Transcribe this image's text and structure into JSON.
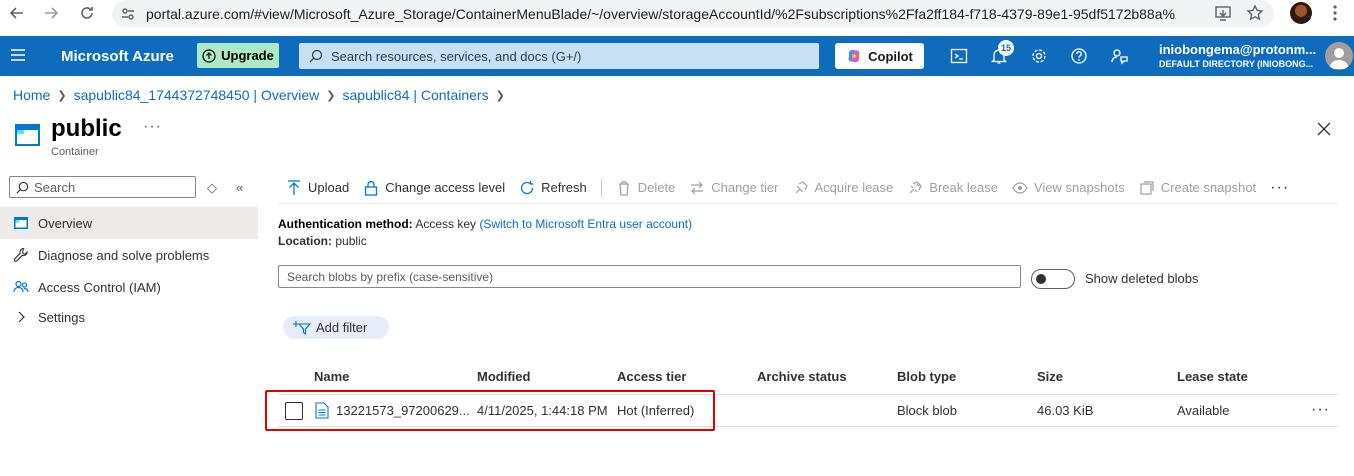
{
  "browser": {
    "url": "portal.azure.com/#view/Microsoft_Azure_Storage/ContainerMenuBlade/~/overview/storageAccountId/%2Fsubscriptions%2Ffa2ff184-f718-4379-89e1-95df5172b88a%2..."
  },
  "header": {
    "brand": "Microsoft Azure",
    "upgrade_label": "Upgrade",
    "search_placeholder": "Search resources, services, and docs (G+/)",
    "copilot_label": "Copilot",
    "notification_count": "15",
    "user_name": "iniobongema@protonm...",
    "user_directory": "DEFAULT DIRECTORY (INIOBONG..."
  },
  "breadcrumb": [
    "Home",
    "sapublic84_1744372748450 | Overview",
    "sapublic84 | Containers"
  ],
  "page": {
    "title": "public",
    "subtitle": "Container",
    "more": "···"
  },
  "sidebar": {
    "search_placeholder": "Search",
    "items": [
      {
        "label": "Overview"
      },
      {
        "label": "Diagnose and solve problems"
      },
      {
        "label": "Access Control (IAM)"
      },
      {
        "label": "Settings"
      }
    ]
  },
  "toolbar": {
    "upload": "Upload",
    "change_access": "Change access level",
    "refresh": "Refresh",
    "delete": "Delete",
    "change_tier": "Change tier",
    "acquire_lease": "Acquire lease",
    "break_lease": "Break lease",
    "view_snapshots": "View snapshots",
    "create_snapshot": "Create snapshot",
    "more": "···"
  },
  "info": {
    "auth_label": "Authentication method:",
    "auth_value": "Access key",
    "auth_link": "(Switch to Microsoft Entra user account)",
    "location_label": "Location:",
    "location_value": "public"
  },
  "blob_search_placeholder": "Search blobs by prefix (case-sensitive)",
  "show_deleted_label": "Show deleted blobs",
  "add_filter_label": "Add filter",
  "table": {
    "headers": [
      "Name",
      "Modified",
      "Access tier",
      "Archive status",
      "Blob type",
      "Size",
      "Lease state"
    ],
    "rows": [
      {
        "name": "13221573_97200629...",
        "modified": "4/11/2025, 1:44:18 PM",
        "access_tier": "Hot (Inferred)",
        "archive_status": "",
        "blob_type": "Block blob",
        "size": "46.03 KiB",
        "lease_state": "Available",
        "more": "···"
      }
    ]
  },
  "colors": {
    "header_bg": "#0f6cbd",
    "link": "#0f6cbd",
    "highlight": "#e00000",
    "upgrade_bg": "#abe9c7"
  }
}
